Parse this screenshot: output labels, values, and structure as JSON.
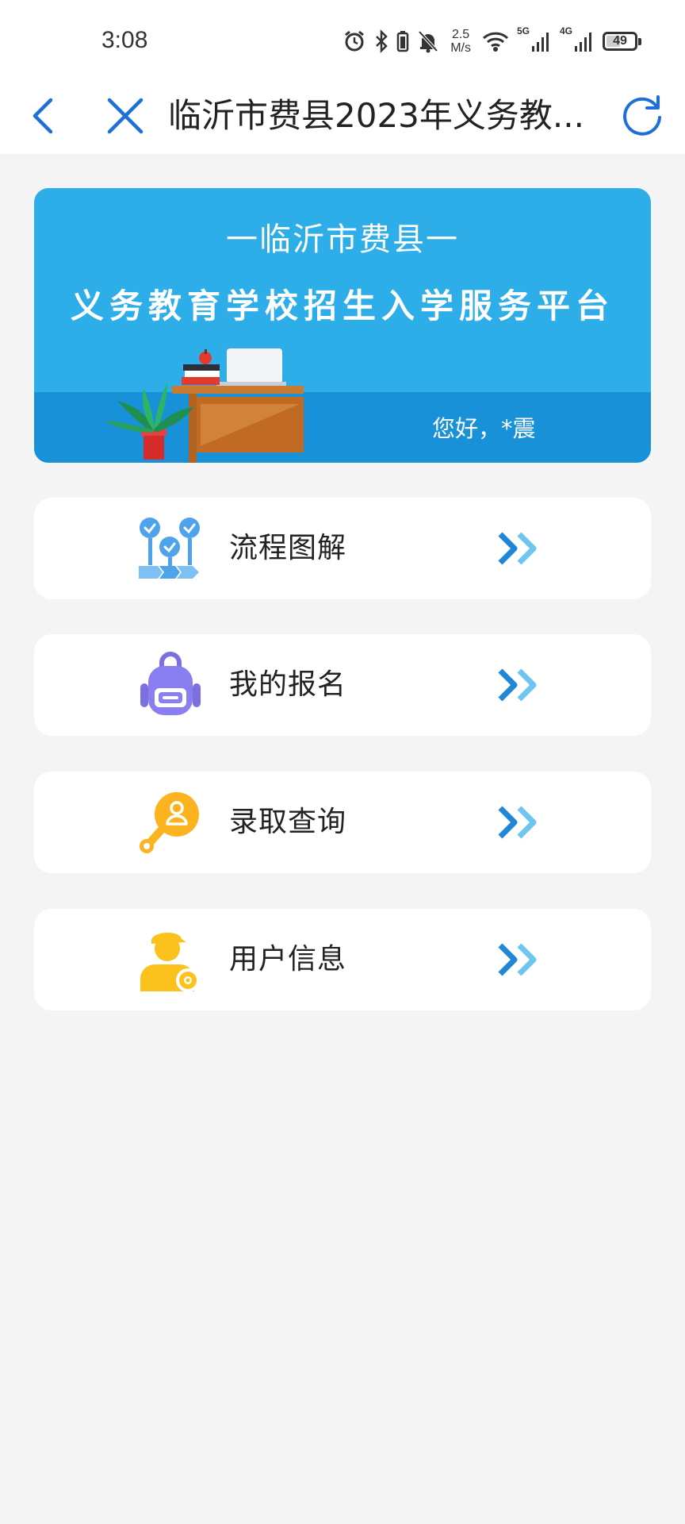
{
  "status_bar": {
    "time": "3:08",
    "speed_value": "2.5",
    "speed_unit": "M/s",
    "sig1_label": "5G",
    "sig2_label": "4G",
    "battery": "49"
  },
  "nav": {
    "title": "临沂市费县2023年义务教...",
    "back_icon": "chevron-left-icon",
    "close_icon": "close-icon",
    "refresh_icon": "refresh-icon",
    "accent_color": "#1e6fd9"
  },
  "banner": {
    "subtitle": "一临沂市费县一",
    "title": "义务教育学校招生入学服务平台",
    "greeting": "您好，*震",
    "bg_color": "#2eaee8",
    "floor_color": "#1891d9"
  },
  "menu": {
    "items": [
      {
        "label": "流程图解",
        "icon": "flowchart-icon"
      },
      {
        "label": "我的报名",
        "icon": "backpack-icon"
      },
      {
        "label": "录取查询",
        "icon": "search-person-icon"
      },
      {
        "label": "用户信息",
        "icon": "user-settings-icon"
      }
    ],
    "arrow_icon": "double-chevron-right-icon"
  }
}
